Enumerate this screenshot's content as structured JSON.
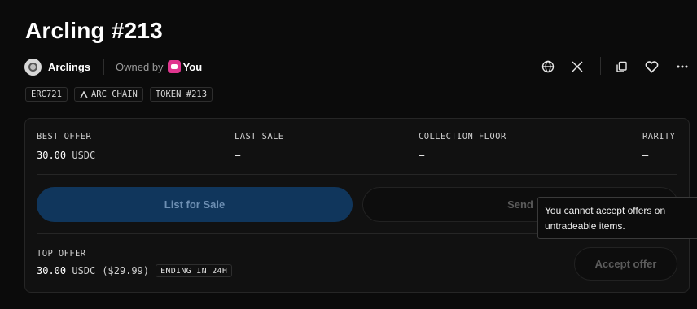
{
  "item": {
    "title": "Arcling #213"
  },
  "collection": {
    "name": "Arclings",
    "owned_by_label": "Owned by",
    "owner": "You"
  },
  "header_actions": [
    {
      "icon": "globe-icon"
    },
    {
      "icon": "x-twitter-icon"
    },
    {
      "icon": "copy-icon"
    },
    {
      "icon": "heart-icon"
    },
    {
      "icon": "more-icon"
    }
  ],
  "tags": {
    "standard": "ERC721",
    "chain": "ARC CHAIN",
    "token": "TOKEN #213"
  },
  "stats": {
    "best_offer": {
      "label": "BEST OFFER",
      "amount": "30.00",
      "unit": "USDC"
    },
    "last_sale": {
      "label": "LAST SALE",
      "value": "—"
    },
    "collection_floor": {
      "label": "COLLECTION FLOOR",
      "value": "—"
    },
    "rarity": {
      "label": "RARITY",
      "value": "—"
    }
  },
  "buttons": {
    "list_for_sale": "List for Sale",
    "send": "Send",
    "accept_offer": "Accept offer"
  },
  "top_offer": {
    "label": "TOP OFFER",
    "amount": "30.00",
    "unit": "USDC",
    "usd": "($29.99)",
    "ending": "ENDING IN 24H"
  },
  "tooltip": {
    "text": "You cannot accept offers on untradeable items."
  },
  "colors": {
    "background": "#0b0b0b",
    "panel": "#111111",
    "primary_button": "#10365c",
    "owner_avatar": "#e0368f"
  }
}
